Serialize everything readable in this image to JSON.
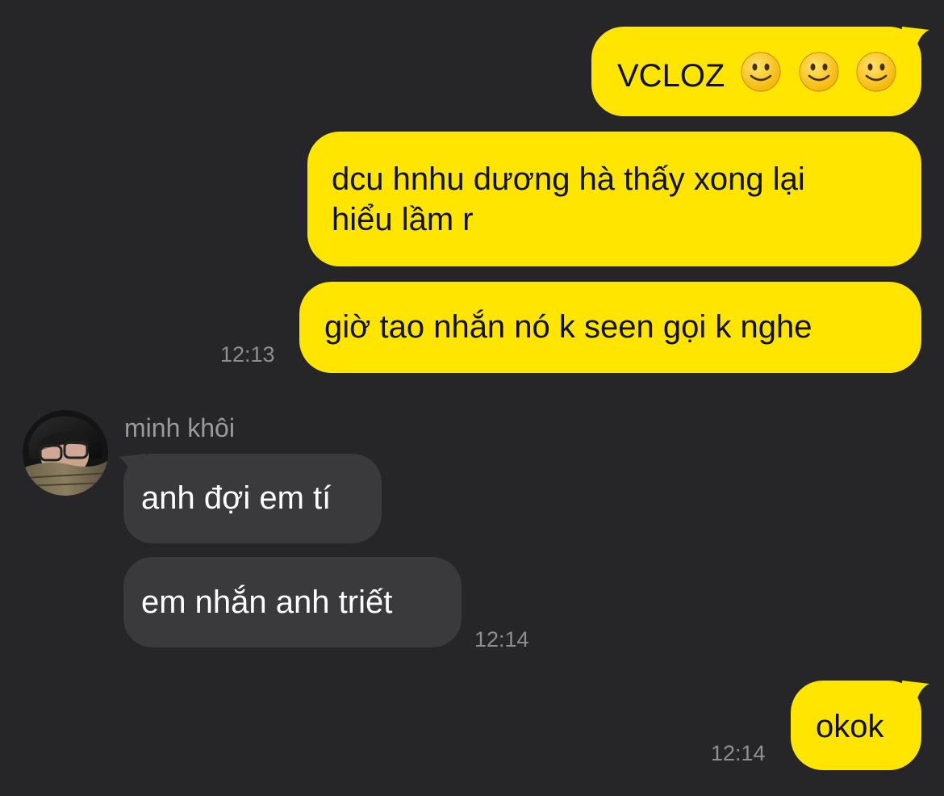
{
  "messages": {
    "m1": {
      "text": "VCLOZ",
      "emoji": [
        "slightly-smiling-face",
        "slightly-smiling-face",
        "slightly-smiling-face"
      ]
    },
    "m2": {
      "line1": "dcu hnhu dương hà thấy xong lại",
      "line2": "hiểu lầm r"
    },
    "m3": {
      "text": "giờ tao nhắn nó k seen gọi k nghe",
      "time": "12:13"
    },
    "sender": {
      "name": "minh khôi"
    },
    "m4": {
      "text": "anh đợi em tí"
    },
    "m5": {
      "text": "em nhắn anh triết",
      "time": "12:14"
    },
    "m6": {
      "text": "okok",
      "time": "12:14"
    }
  },
  "colors": {
    "background": "#262628",
    "sent_bubble": "#FFE500",
    "received_bubble": "#3A3A3C",
    "timestamp": "#8E8E93"
  }
}
